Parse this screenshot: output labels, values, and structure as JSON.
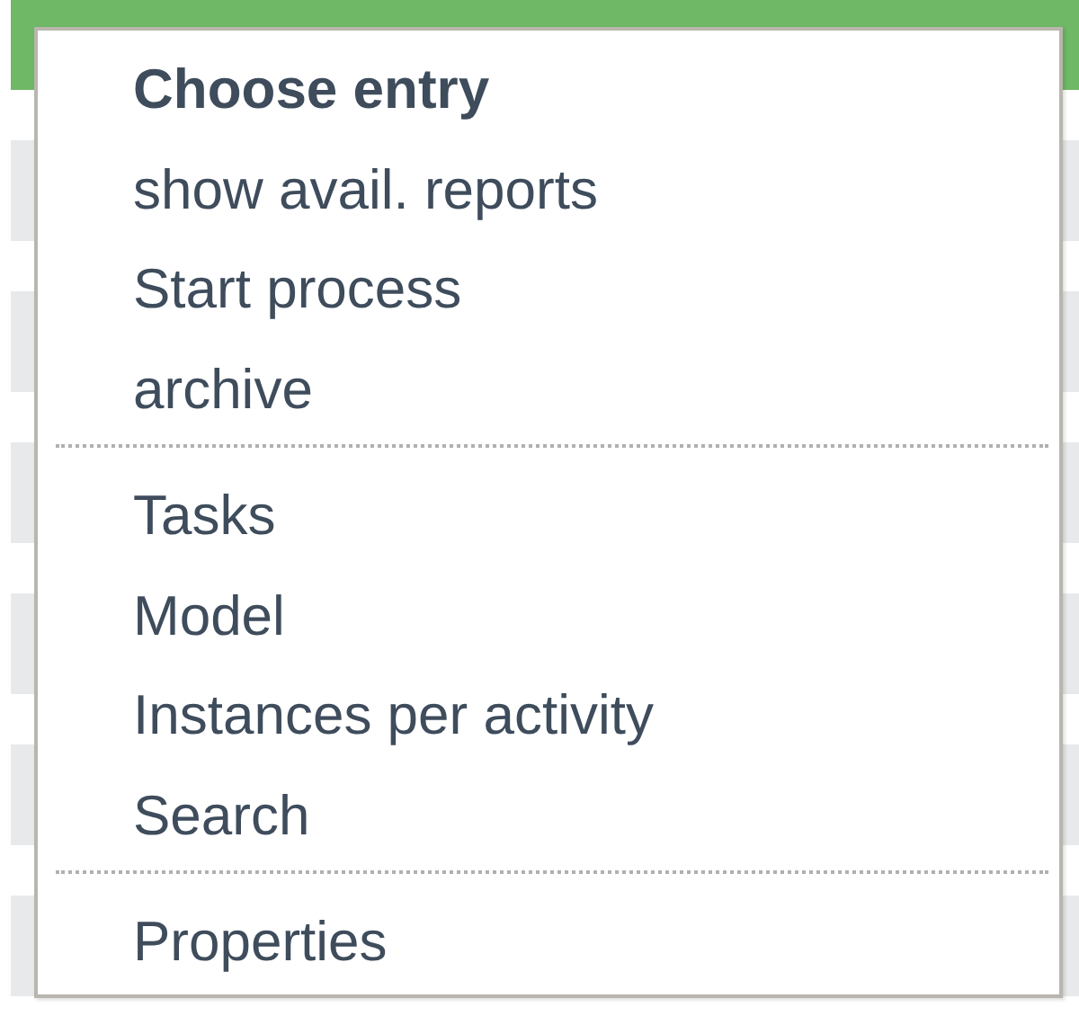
{
  "menu": {
    "groups": [
      {
        "items": [
          {
            "label": "Choose entry",
            "kind": "header"
          },
          {
            "label": "show avail. reports",
            "kind": "item"
          },
          {
            "label": "Start process",
            "kind": "item"
          },
          {
            "label": "archive",
            "kind": "item"
          }
        ]
      },
      {
        "items": [
          {
            "label": "Tasks",
            "kind": "item"
          },
          {
            "label": "Model",
            "kind": "item"
          },
          {
            "label": "Instances per activity",
            "kind": "item"
          },
          {
            "label": "Search",
            "kind": "item"
          }
        ]
      },
      {
        "items": [
          {
            "label": "Properties",
            "kind": "item"
          }
        ]
      }
    ]
  }
}
